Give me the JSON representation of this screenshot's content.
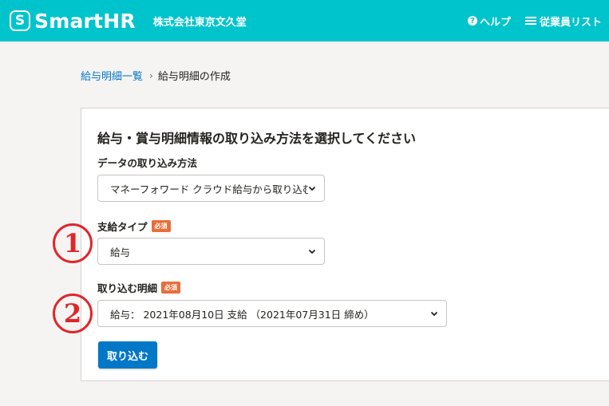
{
  "header": {
    "logo_mark": "S",
    "logo_text": "SmartHR",
    "company": "株式会社東京文久堂",
    "help_icon_glyph": "?",
    "help_label": "ヘルプ",
    "employee_list_label": "従業員リスト",
    "background_color": "#00c4cc"
  },
  "breadcrumb": {
    "parent": "給与明細一覧",
    "separator": "›",
    "current": "給与明細の作成"
  },
  "panel": {
    "title": "給与・賞与明細情報の取り込み方法を選択してください",
    "import_method": {
      "label": "データの取り込み方法",
      "value": "マネーフォワード クラウド給与から取り込む"
    },
    "pay_type": {
      "label": "支給タイプ",
      "required_badge": "必須",
      "value": "給与"
    },
    "statement": {
      "label": "取り込む明細",
      "required_badge": "必須",
      "value": "給与： 2021年08月10日 支給 （2021年07月31日 締め）"
    },
    "submit_label": "取り込む"
  },
  "annotations": {
    "marker1": "1",
    "marker2": "2",
    "marker_color": "#e0262b"
  }
}
